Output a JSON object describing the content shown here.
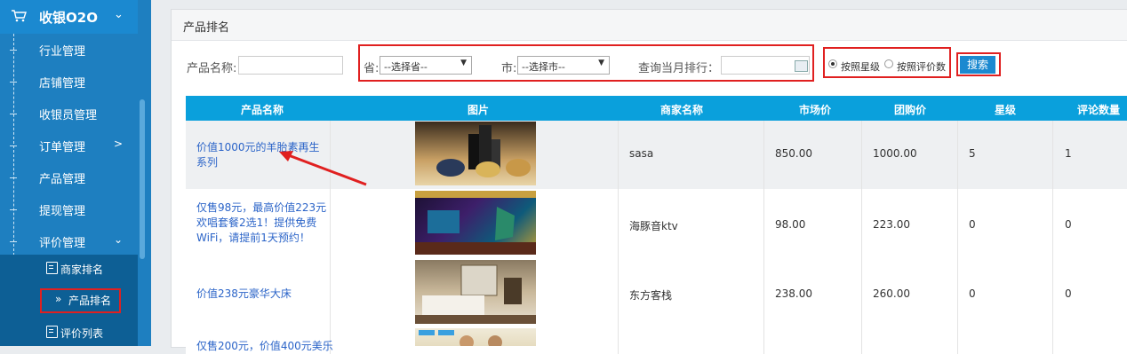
{
  "sidebar": {
    "title": "收银O2O",
    "items": [
      {
        "label": "行业管理"
      },
      {
        "label": "店铺管理"
      },
      {
        "label": "收银员管理"
      },
      {
        "label": "订单管理"
      },
      {
        "label": "产品管理"
      },
      {
        "label": "提现管理"
      },
      {
        "label": "评价管理"
      }
    ],
    "subitems": [
      {
        "label": "商家排名"
      },
      {
        "label": "产品排名"
      },
      {
        "label": "评价列表"
      }
    ]
  },
  "panel": {
    "title": "产品排名"
  },
  "filters": {
    "product_name_label": "产品名称:",
    "province_label": "省:",
    "province_value": "--选择省--",
    "city_label": "市:",
    "city_value": "--选择市--",
    "month_label": "查询当月排行：",
    "radio_star": "按照星级",
    "radio_review": "按照评价数",
    "search_button": "搜索"
  },
  "table": {
    "headers": [
      "产品名称",
      "图片",
      "商家名称",
      "市场价",
      "团购价",
      "星级",
      "评论数量"
    ],
    "rows": [
      {
        "name": "价值1000元的羊胎素再生系列",
        "merchant": "sasa",
        "market": "850.00",
        "group": "1000.00",
        "stars": "5",
        "reviews": "1"
      },
      {
        "name": "仅售98元，最高价值223元欢唱套餐2选1！提供免费WiFi，请提前1天预约！",
        "merchant": "海豚音ktv",
        "market": "98.00",
        "group": "223.00",
        "stars": "0",
        "reviews": "0"
      },
      {
        "name": "价值238元豪华大床",
        "merchant": "东方客栈",
        "market": "238.00",
        "group": "260.00",
        "stars": "0",
        "reviews": "0"
      },
      {
        "name": "仅售200元，价值400元美乐",
        "merchant": "",
        "market": "",
        "group": "",
        "stars": "",
        "reviews": ""
      }
    ]
  },
  "colors": {
    "accent": "#0aa0dc",
    "sidebar": "#1e7fc0",
    "highlight": "#e02020"
  }
}
